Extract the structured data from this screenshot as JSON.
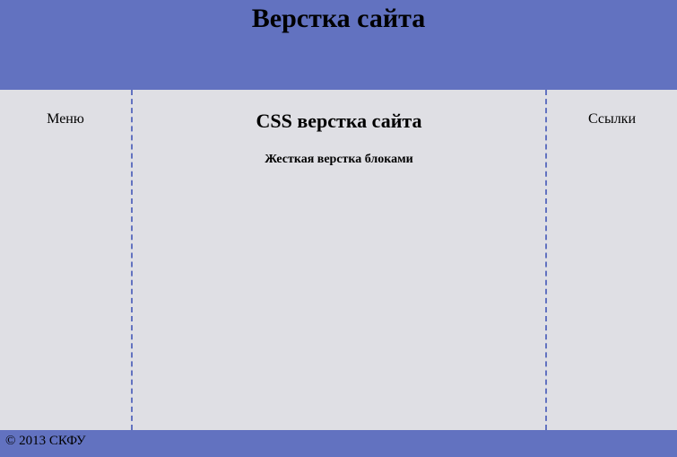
{
  "header": {
    "title": "Верстка сайта"
  },
  "sidebar_left": {
    "title": "Меню"
  },
  "main": {
    "title": "CSS верстка сайта",
    "subtitle": "Жесткая верстка блоками"
  },
  "sidebar_right": {
    "title": "Ссылки"
  },
  "footer": {
    "copyright": "© 2013 СКФУ"
  }
}
